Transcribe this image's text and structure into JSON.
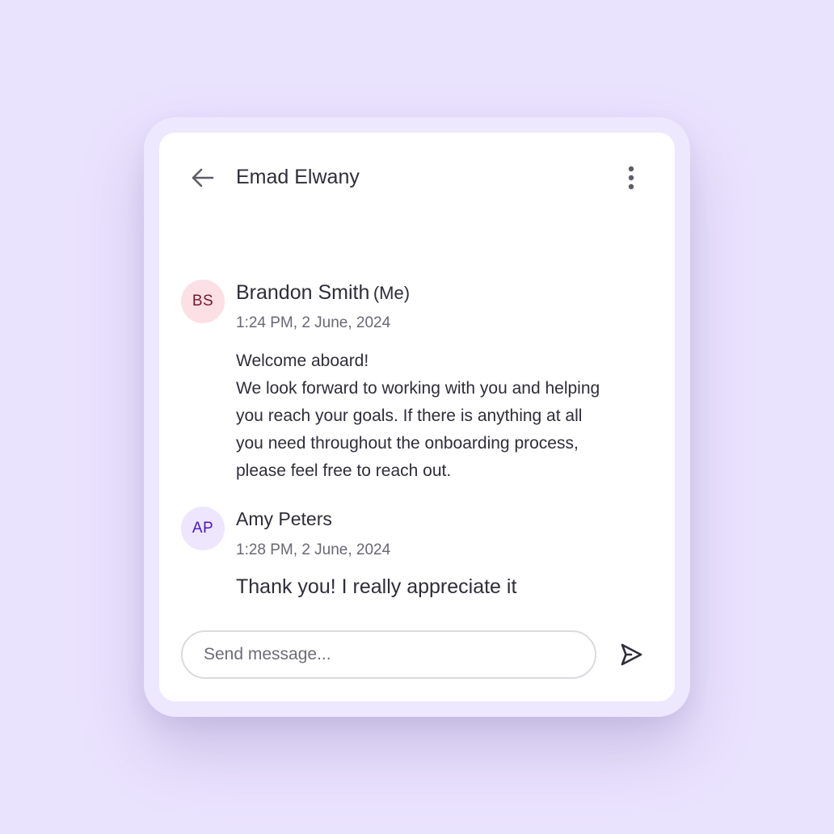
{
  "header": {
    "contact_name": "Emad Elwany",
    "back_icon": "arrow-left-icon",
    "more_icon": "more-vertical-icon"
  },
  "messages": [
    {
      "avatar_initials": "BS",
      "sender_name": "Brandon Smith",
      "sender_tag": "(Me)",
      "timestamp": "1:24 PM, 2 June, 2024",
      "body_lines": [
        "Welcome aboard!",
        "We look forward to working with you and helping",
        "you reach your goals. If there is anything at all",
        "you need throughout the onboarding process,",
        "please feel free to reach out."
      ]
    },
    {
      "avatar_initials": "AP",
      "sender_name": "Amy Peters",
      "timestamp": "1:28 PM, 2 June, 2024",
      "body": "Thank you! I really appreciate it"
    }
  ],
  "composer": {
    "placeholder": "Send message...",
    "value": "",
    "send_icon": "send-icon"
  },
  "colors": {
    "page_background": "#EAE3FE",
    "frame_background": "#EEE8FE",
    "card_background": "#FFFFFF",
    "text_primary": "#302D3A",
    "text_secondary": "#6A6775",
    "avatar_bs_bg": "#FCE0E6",
    "avatar_bs_fg": "#7A1530",
    "avatar_ap_bg": "#EDE6FE",
    "avatar_ap_fg": "#4A18C0"
  }
}
